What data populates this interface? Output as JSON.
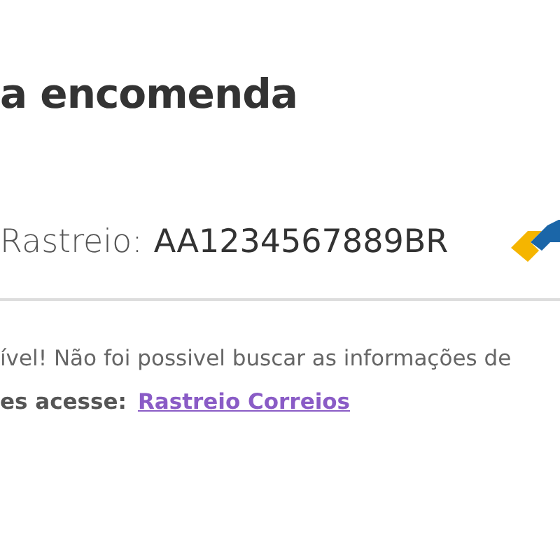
{
  "title": "a encomenda",
  "tracking": {
    "label": "Rastreio:",
    "code": "AA1234567889BR"
  },
  "message": {
    "text": "ível! Não foi possivel buscar as informações de"
  },
  "hint": {
    "text": "es acesse:",
    "link": "Rastreio Correios"
  }
}
